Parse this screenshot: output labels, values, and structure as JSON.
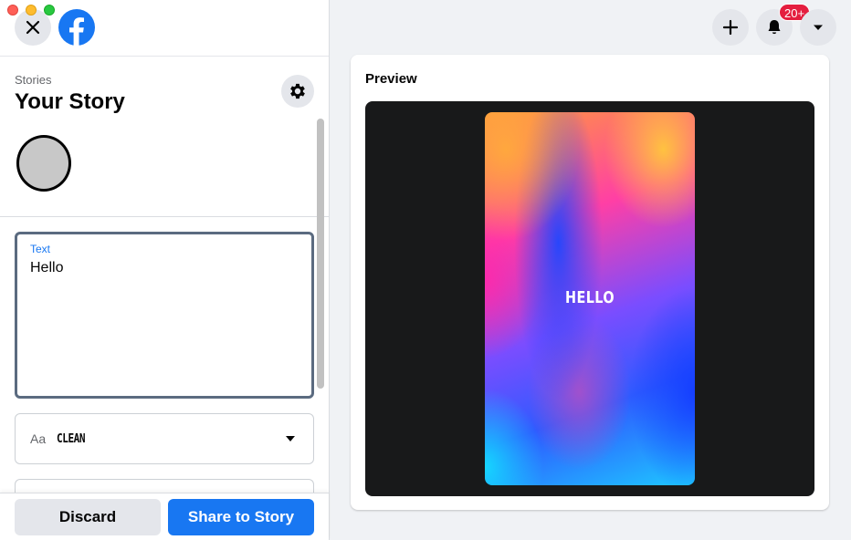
{
  "sidebar": {
    "section_label": "Stories",
    "title": "Your Story",
    "text_field": {
      "label": "Text",
      "value": "Hello"
    },
    "font_select": {
      "icon_text": "Aa",
      "selected": "CLEAN"
    },
    "footer": {
      "discard_label": "Discard",
      "share_label": "Share to Story"
    }
  },
  "topbar": {
    "notifications_badge": "20+"
  },
  "preview": {
    "title": "Preview",
    "story_text": "HELLO"
  },
  "colors": {
    "brand_blue": "#1877f2",
    "badge_red": "#e41e3f",
    "stage_dark": "#18191a"
  },
  "icons": {
    "close": "close-icon",
    "logo": "facebook-logo",
    "settings": "gear-icon",
    "create": "plus-icon",
    "notifications": "bell-icon",
    "account_menu": "caret-down-icon"
  }
}
